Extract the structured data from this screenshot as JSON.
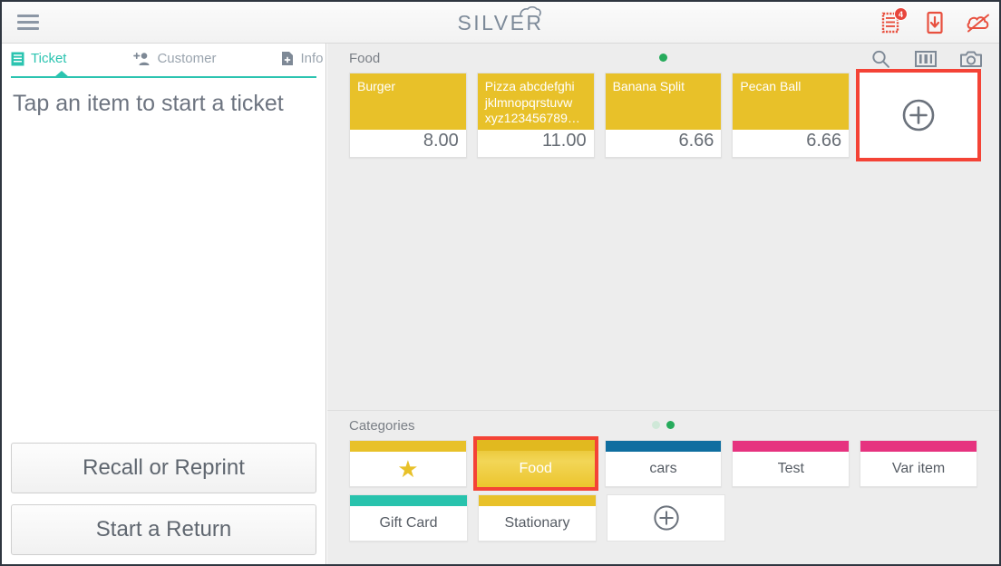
{
  "app": {
    "logo_text": "SILVER",
    "menu_icon": "hamburger-menu-icon"
  },
  "topbar": {
    "icons": [
      {
        "name": "open-tickets-icon",
        "badge": "4"
      },
      {
        "name": "download-to-device-icon",
        "badge": ""
      },
      {
        "name": "cloud-offline-icon",
        "badge": ""
      }
    ]
  },
  "left_panel": {
    "tabs": [
      {
        "label": "Ticket",
        "icon": "ticket-icon",
        "active": true
      },
      {
        "label": "Customer",
        "icon": "add-customer-icon",
        "active": false
      },
      {
        "label": "Info",
        "icon": "info-document-icon",
        "active": false
      }
    ],
    "empty_message": "Tap an item to start a ticket",
    "buttons": [
      {
        "label": "Recall or Reprint"
      },
      {
        "label": "Start a Return"
      }
    ]
  },
  "items": {
    "section_title": "Food",
    "page_dots": [
      {
        "active": true
      }
    ],
    "toolbar_icons": [
      {
        "name": "search-icon"
      },
      {
        "name": "barcode-icon"
      },
      {
        "name": "camera-icon"
      }
    ],
    "tiles": [
      {
        "name": "Burger",
        "price": "8.00"
      },
      {
        "name": "Pizza abcdefghi jklmnopqrstuvw xyz123456789…",
        "price": "11.00"
      },
      {
        "name": "Banana Split",
        "price": "6.66"
      },
      {
        "name": "Pecan Ball",
        "price": "6.66"
      }
    ],
    "add_tile": {
      "icon": "add-item-icon",
      "highlighted": true
    }
  },
  "categories": {
    "section_title": "Categories",
    "page_dots": [
      {
        "active": false
      },
      {
        "active": true
      }
    ],
    "row1": [
      {
        "label": "",
        "icon": "star-icon",
        "bar_color": "#e8c129",
        "selected": false
      },
      {
        "label": "Food",
        "icon": "",
        "bar_color": "#e8c129",
        "selected": true,
        "highlighted": true
      },
      {
        "label": "cars",
        "icon": "",
        "bar_color": "#0f6ea0",
        "selected": false
      },
      {
        "label": "Test",
        "icon": "",
        "bar_color": "#e6337f",
        "selected": false
      },
      {
        "label": "Var item",
        "icon": "",
        "bar_color": "#e6337f",
        "selected": false
      }
    ],
    "row2": [
      {
        "label": "Gift Card",
        "icon": "",
        "bar_color": "#28c3ad",
        "selected": false
      },
      {
        "label": "Stationary",
        "icon": "",
        "bar_color": "#e8c129",
        "selected": false
      }
    ],
    "add_tile": {
      "icon": "add-category-icon"
    }
  },
  "colors": {
    "accent_teal": "#2bc4b0",
    "tile_yellow": "#e8c129",
    "alert_red": "#e8453c",
    "annotation_red": "#f44336",
    "category_blue": "#0f6ea0",
    "category_pink": "#e6337f",
    "page_dot_green": "#27ab5c"
  }
}
